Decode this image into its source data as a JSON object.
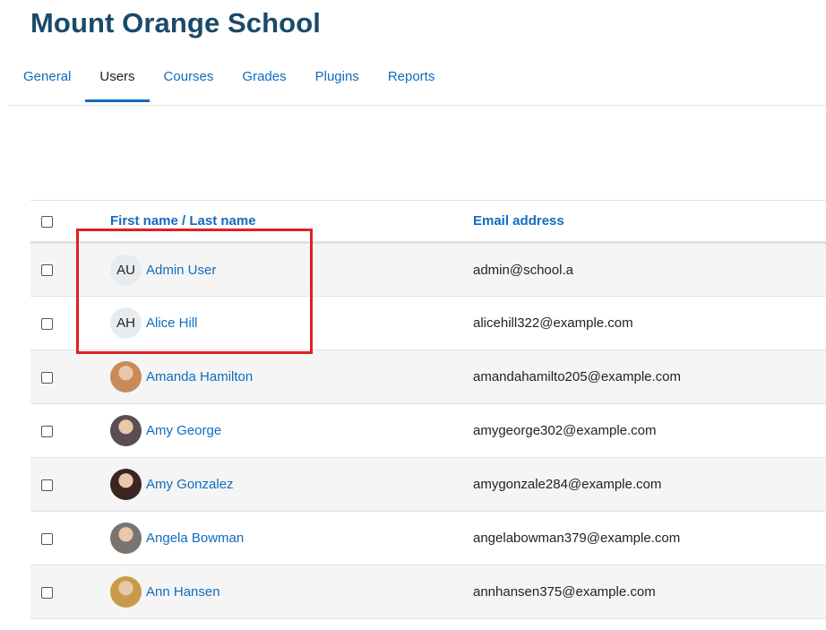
{
  "site": {
    "title": "Mount Orange School"
  },
  "tabs": [
    {
      "label": "General",
      "active": false
    },
    {
      "label": "Users",
      "active": true
    },
    {
      "label": "Courses",
      "active": false
    },
    {
      "label": "Grades",
      "active": false
    },
    {
      "label": "Plugins",
      "active": false
    },
    {
      "label": "Reports",
      "active": false
    }
  ],
  "table": {
    "headers": {
      "name": "First name / Last name",
      "email": "Email address"
    },
    "rows": [
      {
        "name": "Admin User",
        "email": "admin@school.a",
        "avatar": {
          "type": "initials",
          "initials": "AU"
        }
      },
      {
        "name": "Alice Hill",
        "email": "alicehill322@example.com",
        "avatar": {
          "type": "initials",
          "initials": "AH"
        }
      },
      {
        "name": "Amanda Hamilton",
        "email": "amandahamilto205@example.com",
        "avatar": {
          "type": "photo",
          "color": "#c98a5a"
        }
      },
      {
        "name": "Amy George",
        "email": "amygeorge302@example.com",
        "avatar": {
          "type": "photo",
          "color": "#5a4e52"
        }
      },
      {
        "name": "Amy Gonzalez",
        "email": "amygonzale284@example.com",
        "avatar": {
          "type": "photo",
          "color": "#3a2520"
        }
      },
      {
        "name": "Angela Bowman",
        "email": "angelabowman379@example.com",
        "avatar": {
          "type": "photo",
          "color": "#7a7470"
        }
      },
      {
        "name": "Ann Hansen",
        "email": "annhansen375@example.com",
        "avatar": {
          "type": "photo",
          "color": "#c89a4a"
        }
      }
    ]
  },
  "colors": {
    "brand": "#1a4a6b",
    "link": "#0f6cbf",
    "highlight": "#e02020"
  }
}
